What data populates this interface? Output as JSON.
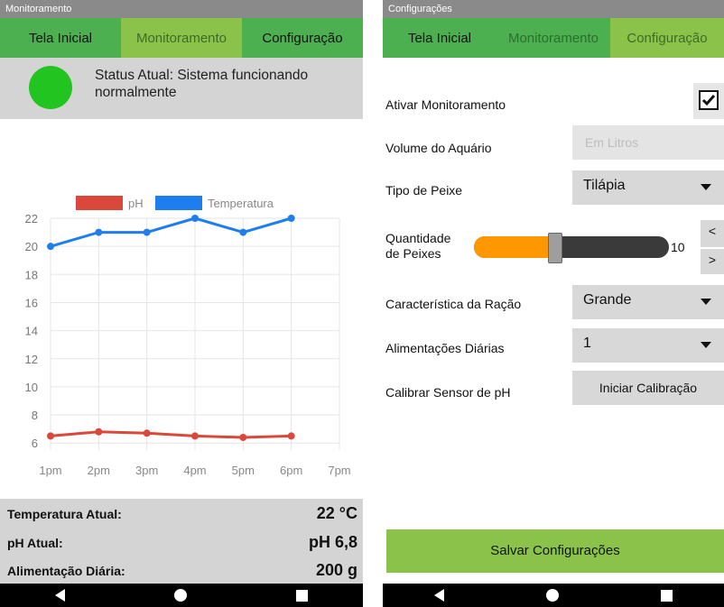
{
  "left": {
    "statusbar": "Monitoramento",
    "tabs": [
      "Tela Inicial",
      "Monitoramento",
      "Configuração"
    ],
    "status_text": "Status Atual: Sistema funcionando normalmente",
    "info": [
      {
        "label": "Temperatura Atual:",
        "value": "22 °C"
      },
      {
        "label": "pH Atual:",
        "value": "pH 6,8"
      },
      {
        "label": "Alimentação Diária:",
        "value": "200 g"
      }
    ]
  },
  "right": {
    "statusbar": "Configurações",
    "tabs": [
      "Tela Inicial",
      "Monitoramento",
      "Configuração"
    ],
    "ativar_label": "Ativar Monitoramento",
    "ativar_checked": true,
    "volume_label": "Volume do Aquário",
    "volume_placeholder": "Em Litros",
    "tipo_label": "Tipo de Peixe",
    "tipo_value": "Tilápia",
    "qtd_label_1": "Quantidade",
    "qtd_label_2": "de Peixes",
    "qtd_value": "10",
    "qtd_fraction": 0.4,
    "stepper_dec": "<",
    "stepper_inc": ">",
    "racao_label": "Característica da Ração",
    "racao_value": "Grande",
    "alim_label": "Alimentações Diárias",
    "alim_value": "1",
    "calib_label": "Calibrar Sensor de pH",
    "calib_button": "Iniciar Calibração",
    "save_button": "Salvar Configurações"
  },
  "colors": {
    "tab_green": "#4caf50",
    "tab_active": "#8bc34a",
    "status_ok": "#22c51f",
    "ph_series": "#d9483b",
    "temp_series": "#1e7ef0",
    "slider_fill": "#ff9800"
  },
  "icons": [
    "back-icon",
    "home-icon",
    "recent-apps-icon",
    "checkmark-icon",
    "chevron-down-icon"
  ],
  "chart_data": {
    "type": "line",
    "categories": [
      "1pm",
      "2pm",
      "3pm",
      "4pm",
      "5pm",
      "6pm",
      "7pm"
    ],
    "series": [
      {
        "name": "pH",
        "values": [
          6.5,
          6.8,
          6.7,
          6.5,
          6.4,
          6.5
        ]
      },
      {
        "name": "Temperatura",
        "values": [
          20,
          21,
          21,
          22,
          21,
          22
        ]
      }
    ],
    "y_ticks": [
      6,
      8,
      10,
      12,
      14,
      16,
      18,
      20,
      22
    ],
    "ylim": [
      5.5,
      22
    ],
    "grid": true,
    "legend": "top"
  }
}
